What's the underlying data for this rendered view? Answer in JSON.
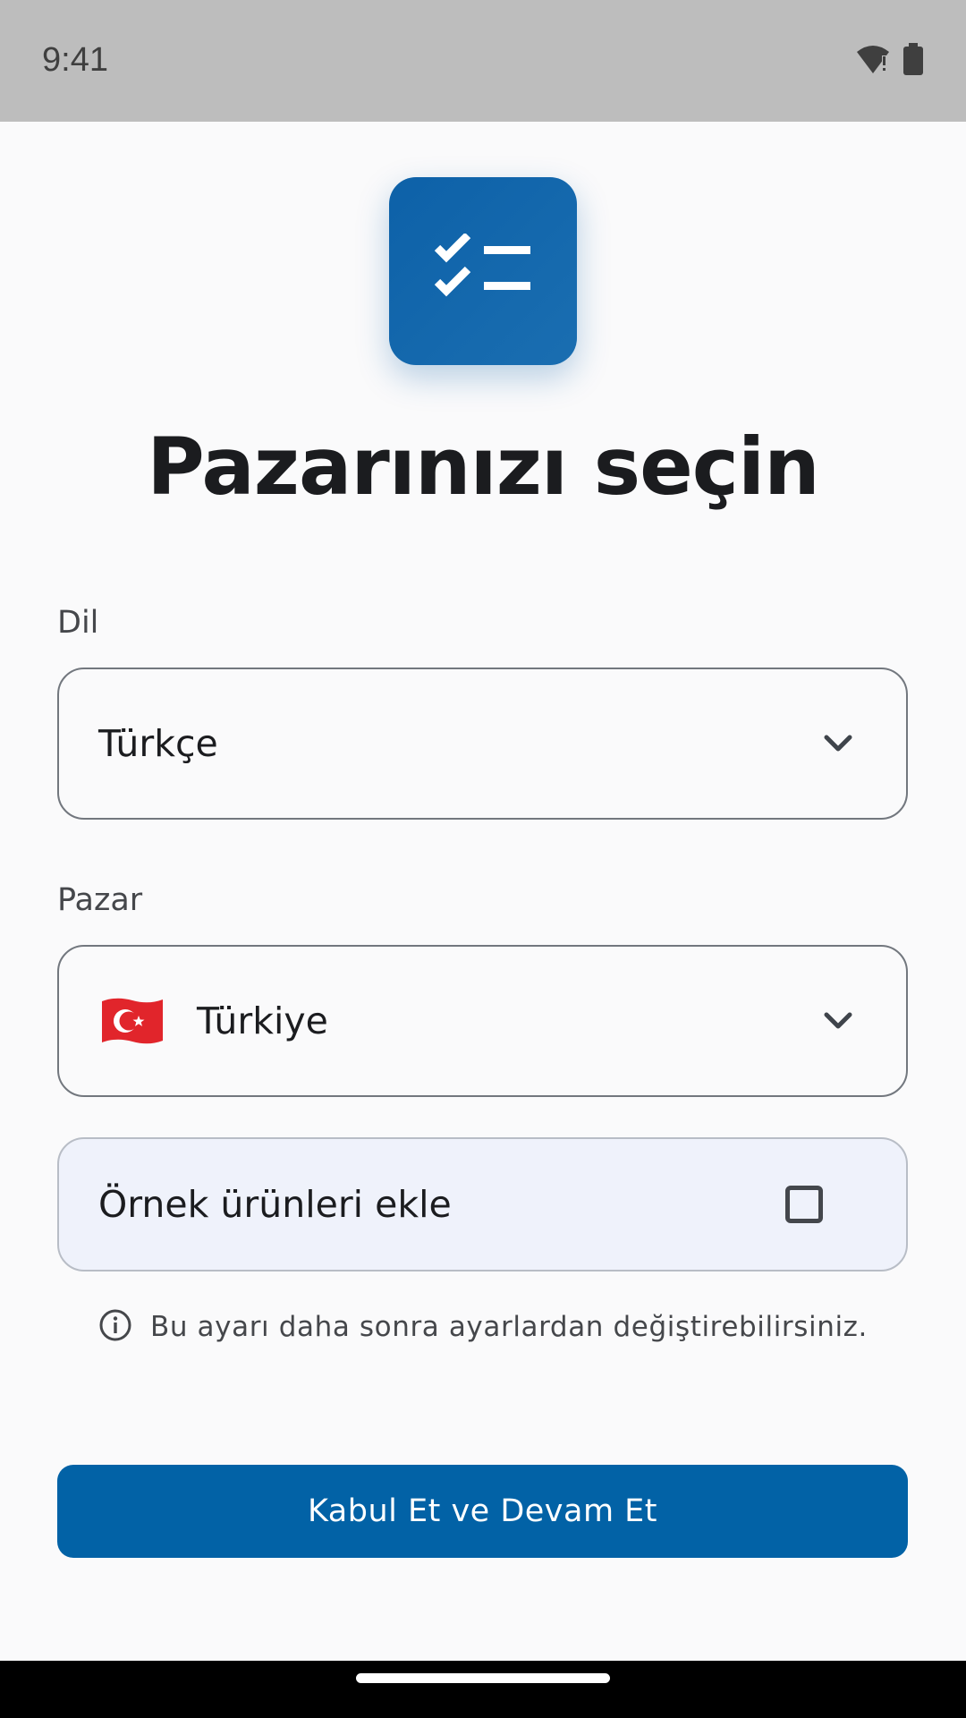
{
  "status_bar": {
    "time": "9:41",
    "icons": [
      "wifi-alert-icon",
      "battery-icon"
    ]
  },
  "app_icon": "checklist-icon",
  "title": "Pazarınızı seçin",
  "language": {
    "label": "Dil",
    "value": "Türkçe"
  },
  "market": {
    "label": "Pazar",
    "value": "Türkiye",
    "flag": "turkey-flag-icon"
  },
  "sample_products": {
    "label": "Örnek ürünleri ekle",
    "checked": false
  },
  "info": {
    "text": "Bu ayarı daha sonra ayarlardan değiştirebilirsiniz.",
    "icon": "info-icon"
  },
  "button": {
    "label": "Kabul Et ve Devam Et"
  },
  "colors": {
    "primary": "#0262a6",
    "checkbox_row_bg": "#eff2fb",
    "status_bar_bg": "#bdbdbd"
  }
}
